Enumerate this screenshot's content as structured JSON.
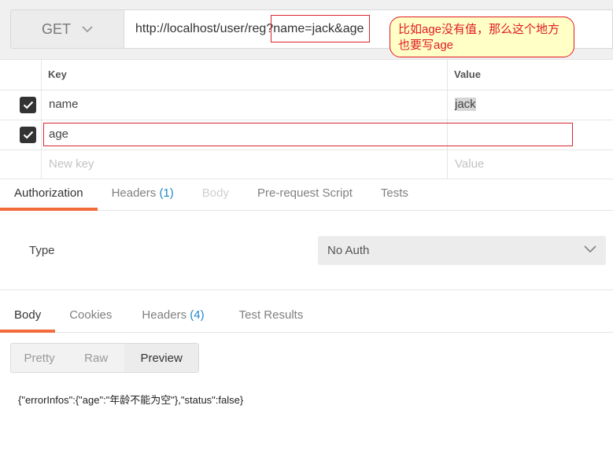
{
  "request": {
    "method": "GET",
    "url": "http://localhost/user/reg?name=jack&age"
  },
  "callout": {
    "text": "比如age没有值，那么这个地方也要写age"
  },
  "params": {
    "headers": {
      "key": "Key",
      "value": "Value"
    },
    "rows": [
      {
        "key": "name",
        "value": "jack",
        "checked": true
      },
      {
        "key": "age",
        "value": "",
        "checked": true
      }
    ],
    "new_key_placeholder": "New key",
    "new_value_placeholder": "Value"
  },
  "request_tabs": [
    {
      "label": "Authorization",
      "count": ""
    },
    {
      "label": "Headers",
      "count": "(1)"
    },
    {
      "label": "Body",
      "count": ""
    },
    {
      "label": "Pre-request Script",
      "count": ""
    },
    {
      "label": "Tests",
      "count": ""
    }
  ],
  "auth": {
    "type_label": "Type",
    "type_value": "No Auth"
  },
  "response_tabs": [
    {
      "label": "Body",
      "count": ""
    },
    {
      "label": "Cookies",
      "count": ""
    },
    {
      "label": "Headers",
      "count": "(4)"
    },
    {
      "label": "Test Results",
      "count": ""
    }
  ],
  "view_modes": [
    "Pretty",
    "Raw",
    "Preview"
  ],
  "response_body": "{\"errorInfos\":{\"age\":\"年龄不能为空\"},\"status\":false}",
  "colors": {
    "accent": "#f26b3a",
    "count_blue": "#1e88c8",
    "highlight_red": "#d9262f",
    "callout_bg": "#ffffc6"
  }
}
